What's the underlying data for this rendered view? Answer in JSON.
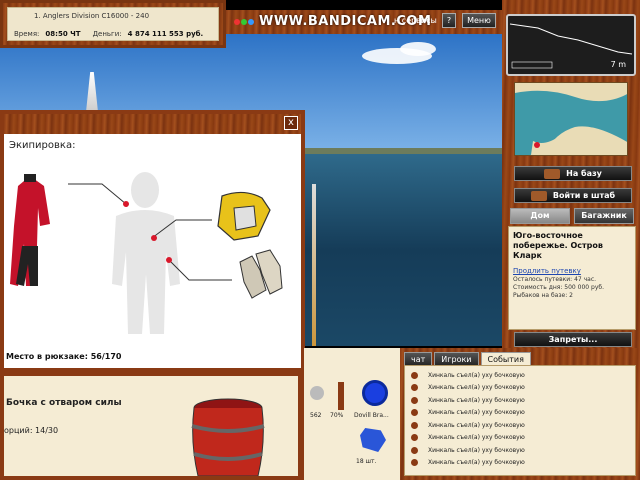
{
  "topbar": {
    "location": "1. Anglers Division C16000 - 240",
    "time_label": "Время:",
    "time_value": "08:50 ЧТ",
    "money_label": "Деньги:",
    "money_value": "4 874 111 553 руб."
  },
  "menu": {
    "watermark": "WWW.BANDICAM.COM",
    "services_label": "н сервисы",
    "help_label": "?",
    "menu_label": "Меню"
  },
  "equipment": {
    "title": "Экипировка:",
    "close_label": "x",
    "backpack_label": "Место в рюкзаке: 56/170"
  },
  "item": {
    "name": "Бочка с отваром силы",
    "portions": "орций: 14/30"
  },
  "inventory": {
    "cells": [
      {
        "count": "562",
        "percent": "70%"
      },
      {
        "name": "Dovill Bra..."
      },
      {
        "count": "18 шт."
      }
    ]
  },
  "right": {
    "depth_value": "7 m",
    "to_base_label": "На базу",
    "headquarters_label": "Войти в штаб",
    "tab_house": "Дом",
    "tab_luggage": "Багажник",
    "location_title": "Юго-восточное побережье. Остров Кларк",
    "extend_link": "Продлить путевку",
    "line1": "Осталось путевки: 47 час.",
    "line2": "Стоимость дня: 500 000 руб.",
    "line3": "Рыбаков на базе: 2",
    "bans_label": "Запреты..."
  },
  "events": {
    "tabs": [
      "чат",
      "Игроки",
      "События"
    ],
    "items": [
      "Хинкаль съел(а) уху бочковую",
      "Хинкаль съел(а) уху бочковую",
      "Хинкаль съел(а) уху бочковую",
      "Хинкаль съел(а) уху бочковую",
      "Хинкаль съел(а) уху бочковую",
      "Хинкаль съел(а) уху бочковую",
      "Хинкаль съел(а) уху бочковую",
      "Хинкаль съел(а) уху бочковую"
    ]
  },
  "colors": {
    "wood": "#8a3a14",
    "panel": "#f5ecd4",
    "marker_red": "#d9182b",
    "link_blue": "#1e46b0"
  }
}
